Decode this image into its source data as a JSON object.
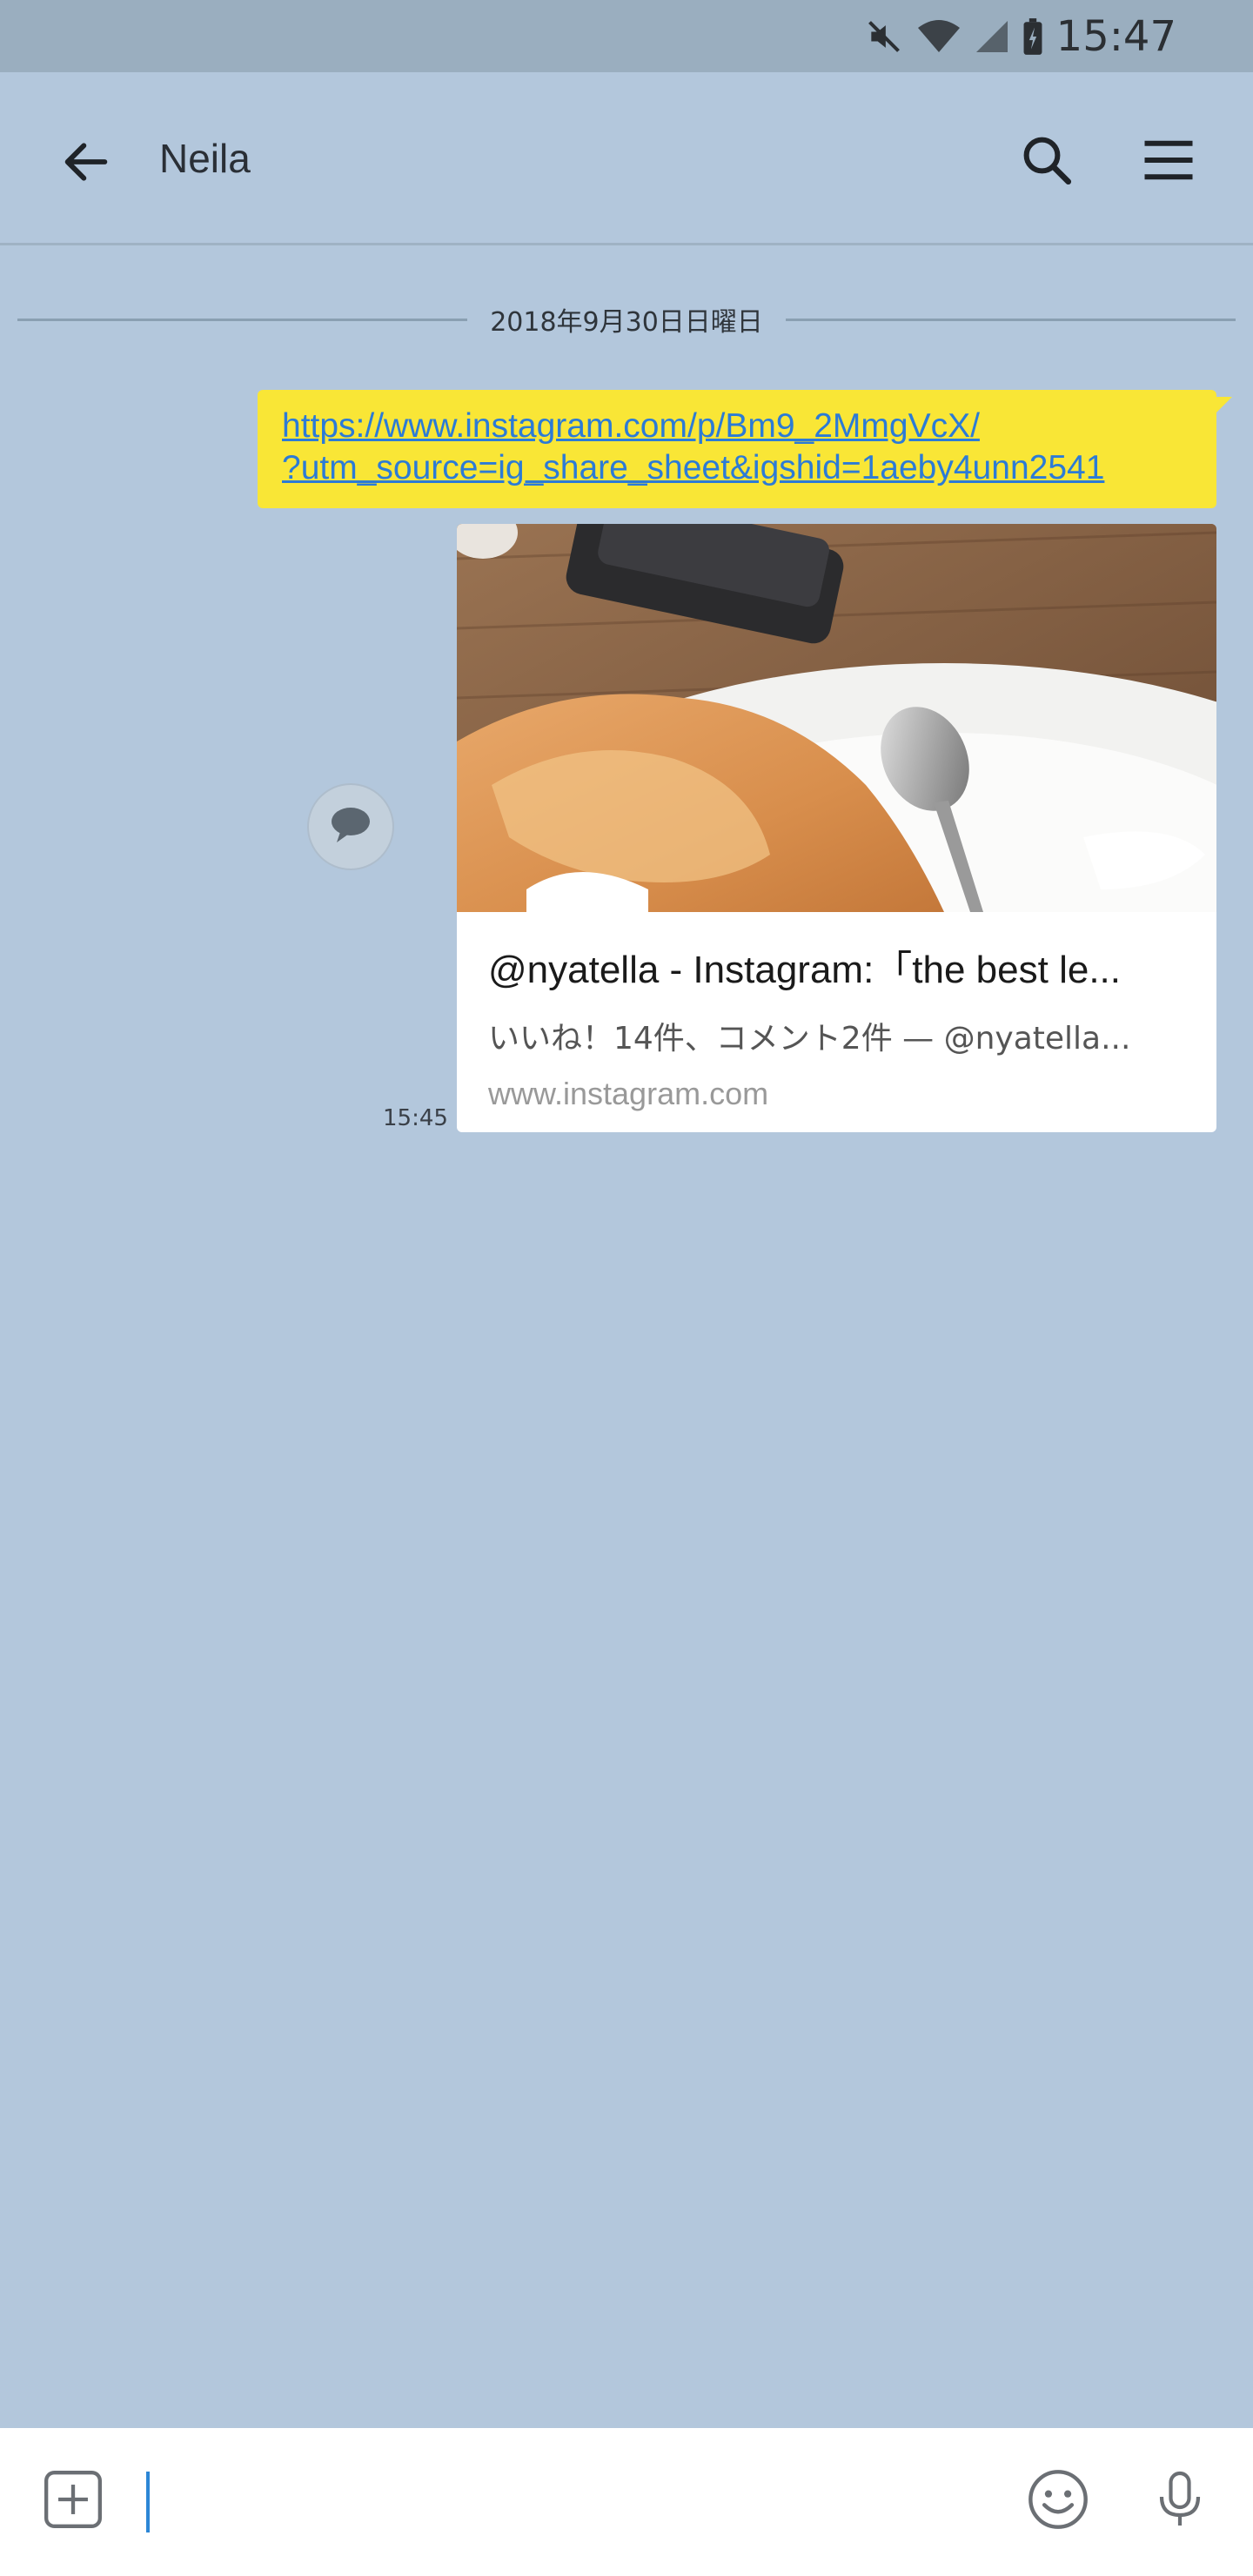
{
  "status_bar": {
    "time": "15:47",
    "icons": [
      "mute-icon",
      "wifi-icon",
      "signal-icon",
      "battery-charging-icon"
    ]
  },
  "header": {
    "title": "Neila",
    "back_icon": "arrow-left-icon",
    "search_icon": "search-icon",
    "menu_icon": "hamburger-menu-icon"
  },
  "chat": {
    "date": "2018年9月30日日曜日",
    "message": {
      "url_line1": "https://www.instagram.com/p/Bm9_2MmgVcX/",
      "url_line2": "?utm_source=ig_share_sheet&igshid=1aeby4unn2541",
      "time": "15:45",
      "bubble_color": "#f9e636",
      "link_color": "#2c7bd6"
    },
    "link_preview": {
      "title": "@nyatella - Instagram:「the best le...",
      "description": "いいね！14件、コメント2件 — @nyatella...",
      "domain": "www.instagram.com",
      "image": "food-photo"
    },
    "share_icon": "speech-bubble-icon"
  },
  "input_bar": {
    "placeholder": "",
    "value": "",
    "plus_icon": "plus-square-icon",
    "emoji_icon": "smiley-icon",
    "mic_icon": "microphone-icon"
  },
  "colors": {
    "background": "#b3c7dc",
    "status_bar": "#9aaebf"
  }
}
